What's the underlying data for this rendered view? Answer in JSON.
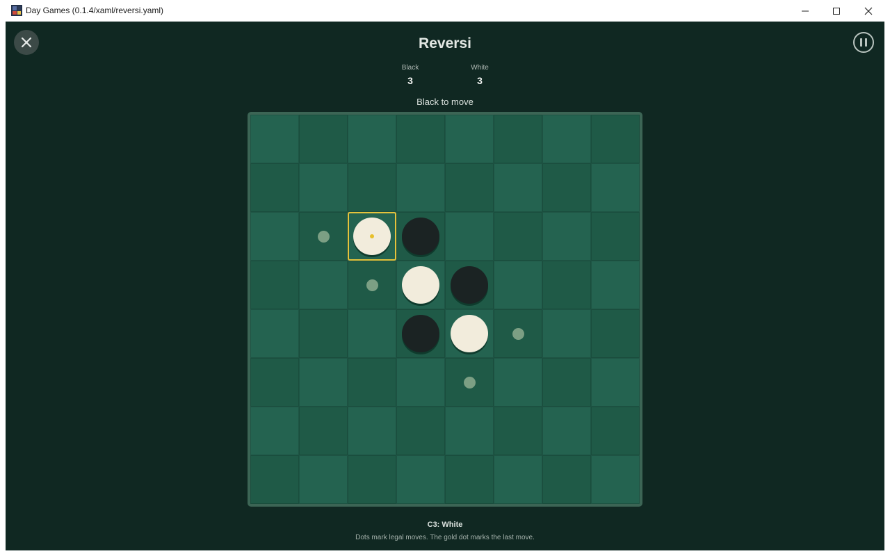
{
  "window": {
    "title": "Day Games (0.1.4/xaml/reversi.yaml)",
    "controls": [
      "minimize-icon",
      "maximize-icon",
      "close-icon"
    ]
  },
  "game": {
    "title": "Reversi",
    "close_icon": "close-icon",
    "pause_icon": "pause-icon"
  },
  "score": {
    "black_label": "Black",
    "black_value": "3",
    "white_label": "White",
    "white_value": "3"
  },
  "status": "Black to move",
  "board": {
    "size": 8,
    "rows": [
      "........",
      "........",
      ".oWB....",
      "..oWB...",
      "...BWo..",
      "....o...",
      "........",
      "........"
    ],
    "legend": {
      "B": "black disc",
      "W": "white disc",
      "o": "legal move dot",
      ".": "empty"
    },
    "last_move": "C3",
    "colors": {
      "light_square": "#246350",
      "dark_square": "#1f5a47",
      "frame": "#3c6555",
      "last_move_border": "#e4c33c",
      "legal_dot": "#7c9f84"
    }
  },
  "footer": {
    "last_move_caption": "C3: White",
    "help_text": "Dots mark legal moves. The gold dot marks the last move."
  }
}
